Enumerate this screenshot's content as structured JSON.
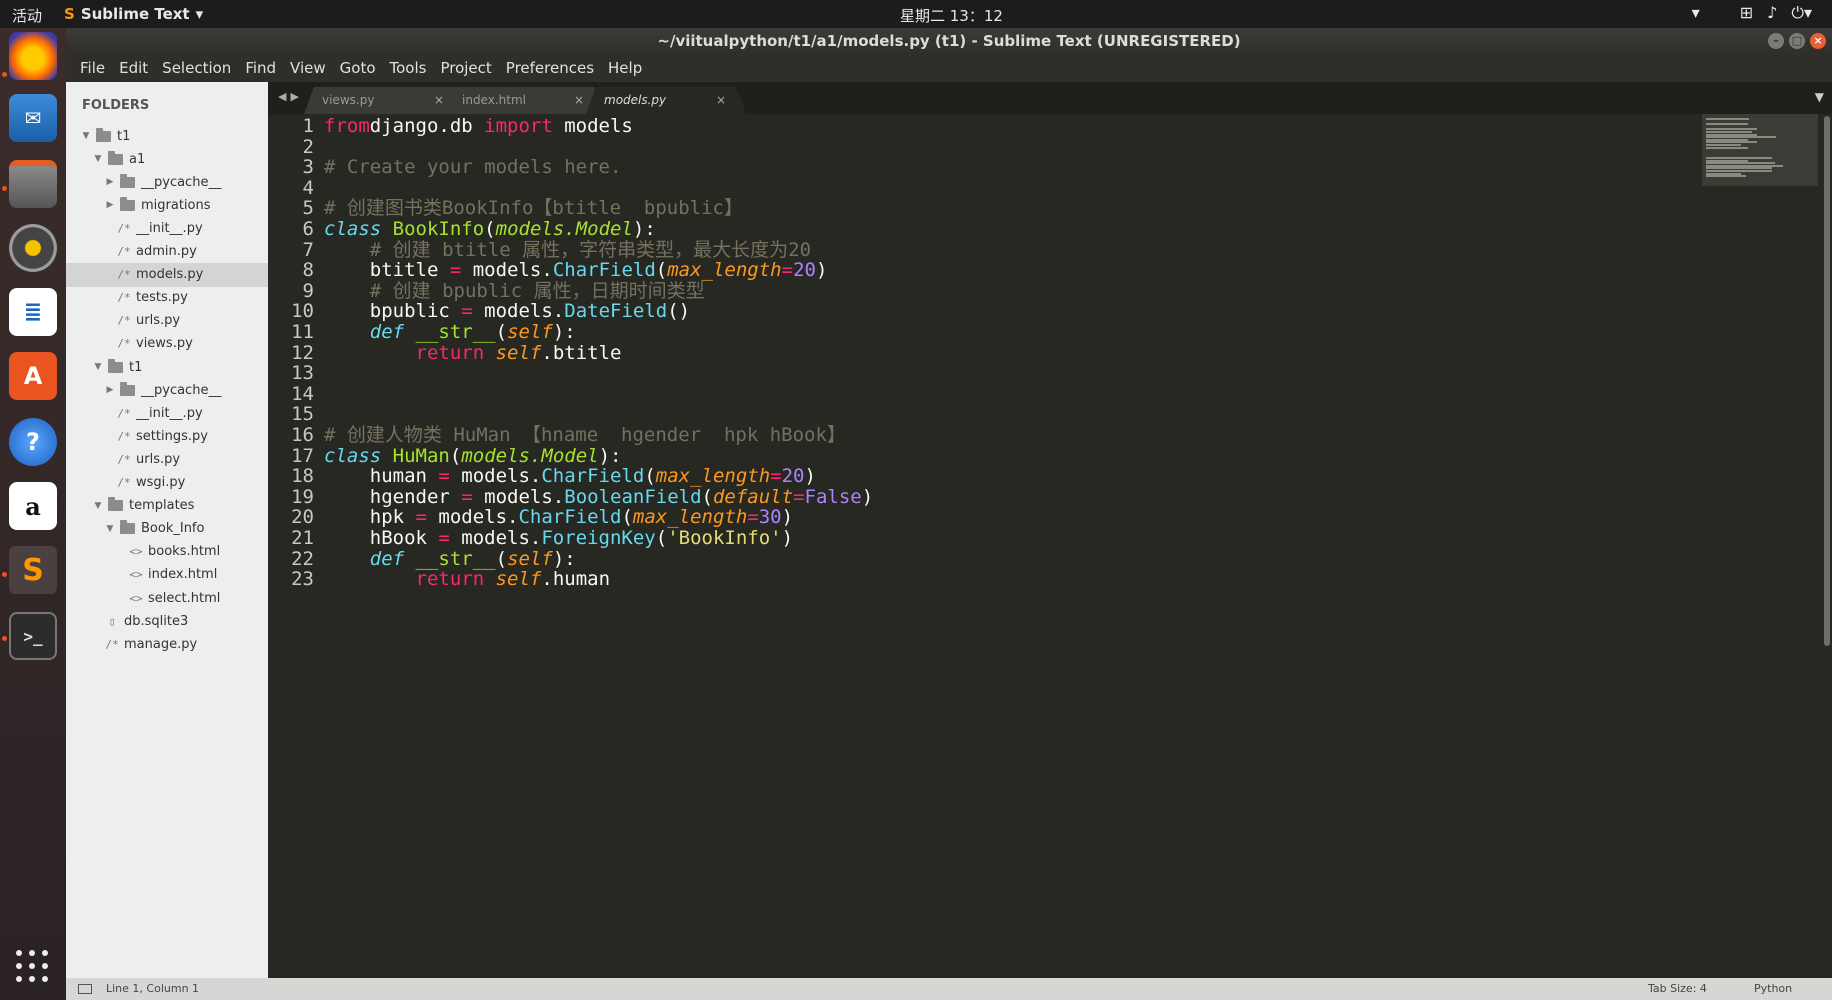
{
  "topbar": {
    "activities": "活动",
    "app_name": "Sublime Text",
    "clock": "星期二 13：12"
  },
  "window": {
    "title": "~/viitualpython/t1/a1/models.py (t1) - Sublime Text (UNREGISTERED)"
  },
  "menu": [
    "File",
    "Edit",
    "Selection",
    "Find",
    "View",
    "Goto",
    "Tools",
    "Project",
    "Preferences",
    "Help"
  ],
  "sidebar": {
    "header": "FOLDERS",
    "items": [
      {
        "label": "t1",
        "kind": "folder",
        "open": true,
        "depth": 0
      },
      {
        "label": "a1",
        "kind": "folder",
        "open": true,
        "depth": 1
      },
      {
        "label": "__pycache__",
        "kind": "folder",
        "open": false,
        "depth": 2
      },
      {
        "label": "migrations",
        "kind": "folder",
        "open": false,
        "depth": 2
      },
      {
        "label": "__init__.py",
        "kind": "py",
        "depth": 2
      },
      {
        "label": "admin.py",
        "kind": "py",
        "depth": 2
      },
      {
        "label": "models.py",
        "kind": "py",
        "depth": 2,
        "selected": true
      },
      {
        "label": "tests.py",
        "kind": "py",
        "depth": 2
      },
      {
        "label": "urls.py",
        "kind": "py",
        "depth": 2
      },
      {
        "label": "views.py",
        "kind": "py",
        "depth": 2
      },
      {
        "label": "t1",
        "kind": "folder",
        "open": true,
        "depth": 1
      },
      {
        "label": "__pycache__",
        "kind": "folder",
        "open": false,
        "depth": 2
      },
      {
        "label": "__init__.py",
        "kind": "py",
        "depth": 2
      },
      {
        "label": "settings.py",
        "kind": "py",
        "depth": 2
      },
      {
        "label": "urls.py",
        "kind": "py",
        "depth": 2
      },
      {
        "label": "wsgi.py",
        "kind": "py",
        "depth": 2
      },
      {
        "label": "templates",
        "kind": "folder",
        "open": true,
        "depth": 1
      },
      {
        "label": "Book_Info",
        "kind": "folder",
        "open": true,
        "depth": 2
      },
      {
        "label": "books.html",
        "kind": "html",
        "depth": 3
      },
      {
        "label": "index.html",
        "kind": "html",
        "depth": 3
      },
      {
        "label": "select.html",
        "kind": "html",
        "depth": 3
      },
      {
        "label": "db.sqlite3",
        "kind": "file",
        "depth": 1
      },
      {
        "label": "manage.py",
        "kind": "py",
        "depth": 1
      }
    ]
  },
  "tabs": [
    {
      "label": "views.py",
      "active": false
    },
    {
      "label": "index.html",
      "active": false
    },
    {
      "label": "models.py",
      "active": true
    }
  ],
  "editor": {
    "line_numbers": [
      "1",
      "2",
      "3",
      "4",
      "5",
      "6",
      "7",
      "8",
      "9",
      "10",
      "11",
      "12",
      "13",
      "14",
      "15",
      "16",
      "17",
      "18",
      "19",
      "20",
      "21",
      "22",
      "23"
    ],
    "lines": [
      [
        [
          "kw",
          "from"
        ],
        [
          "",
          "django.db "
        ],
        [
          "kw",
          "import"
        ],
        [
          "",
          " models"
        ]
      ],
      [],
      [
        [
          "cm",
          "# Create your models here."
        ]
      ],
      [],
      [
        [
          "cm",
          "# 创建图书类BookInfo【btitle  bpublic】"
        ]
      ],
      [
        [
          "st",
          "class"
        ],
        [
          "",
          " "
        ],
        [
          "cls",
          "BookInfo"
        ],
        [
          "",
          "("
        ],
        [
          "inh",
          "models.Model"
        ],
        [
          "",
          "):"
        ]
      ],
      [
        [
          "",
          "    "
        ],
        [
          "cm",
          "# 创建 btitle 属性，字符串类型，最大长度为20"
        ]
      ],
      [
        [
          "",
          "    btitle "
        ],
        [
          "op",
          "="
        ],
        [
          "",
          " models."
        ],
        [
          "fn",
          "CharField"
        ],
        [
          "",
          "("
        ],
        [
          "par",
          "max_length"
        ],
        [
          "op",
          "="
        ],
        [
          "num",
          "20"
        ],
        [
          "",
          ")"
        ]
      ],
      [
        [
          "",
          "    "
        ],
        [
          "cm",
          "# 创建 bpublic 属性，日期时间类型"
        ]
      ],
      [
        [
          "",
          "    bpublic "
        ],
        [
          "op",
          "="
        ],
        [
          "",
          " models."
        ],
        [
          "fn",
          "DateField"
        ],
        [
          "",
          "()"
        ]
      ],
      [
        [
          "",
          "    "
        ],
        [
          "st",
          "def"
        ],
        [
          "",
          " "
        ],
        [
          "dn",
          "__str__"
        ],
        [
          "",
          "("
        ],
        [
          "par",
          "self"
        ],
        [
          "",
          "):"
        ]
      ],
      [
        [
          "",
          "        "
        ],
        [
          "kw",
          "return"
        ],
        [
          "",
          " "
        ],
        [
          "par",
          "self"
        ],
        [
          "",
          ".btitle"
        ]
      ],
      [],
      [],
      [],
      [
        [
          "cm",
          "# 创建人物类 HuMan 【hname  hgender  hpk hBook】"
        ]
      ],
      [
        [
          "st",
          "class"
        ],
        [
          "",
          " "
        ],
        [
          "cls",
          "HuMan"
        ],
        [
          "",
          "("
        ],
        [
          "inh",
          "models.Model"
        ],
        [
          "",
          "):"
        ]
      ],
      [
        [
          "",
          "    human "
        ],
        [
          "op",
          "="
        ],
        [
          "",
          " models."
        ],
        [
          "fn",
          "CharField"
        ],
        [
          "",
          "("
        ],
        [
          "par",
          "max_length"
        ],
        [
          "op",
          "="
        ],
        [
          "num",
          "20"
        ],
        [
          "",
          ")"
        ]
      ],
      [
        [
          "",
          "    hgender "
        ],
        [
          "op",
          "="
        ],
        [
          "",
          " models."
        ],
        [
          "fn",
          "BooleanField"
        ],
        [
          "",
          "("
        ],
        [
          "par",
          "default"
        ],
        [
          "op",
          "="
        ],
        [
          "num",
          "False"
        ],
        [
          "",
          ")"
        ]
      ],
      [
        [
          "",
          "    hpk "
        ],
        [
          "op",
          "="
        ],
        [
          "",
          " models."
        ],
        [
          "fn",
          "CharField"
        ],
        [
          "",
          "("
        ],
        [
          "par",
          "max_length"
        ],
        [
          "op",
          "="
        ],
        [
          "num",
          "30"
        ],
        [
          "",
          ")"
        ]
      ],
      [
        [
          "",
          "    hBook "
        ],
        [
          "op",
          "="
        ],
        [
          "",
          " models."
        ],
        [
          "fn",
          "ForeignKey"
        ],
        [
          "",
          "("
        ],
        [
          "s",
          "'BookInfo'"
        ],
        [
          "",
          ")"
        ]
      ],
      [
        [
          "",
          "    "
        ],
        [
          "st",
          "def"
        ],
        [
          "",
          " "
        ],
        [
          "dn",
          "__str__"
        ],
        [
          "",
          "("
        ],
        [
          "par",
          "self"
        ],
        [
          "",
          "):"
        ]
      ],
      [
        [
          "",
          "        "
        ],
        [
          "kw",
          "return"
        ],
        [
          "",
          " "
        ],
        [
          "par",
          "self"
        ],
        [
          "",
          ".human"
        ]
      ]
    ]
  },
  "status": {
    "position": "Line 1, Column 1",
    "tab_size": "Tab Size: 4",
    "syntax": "Python"
  },
  "colors": {
    "accent": "#e95420",
    "editor_bg": "#272822",
    "keyword": "#f92672",
    "function": "#66d9ef",
    "class": "#a6e22e",
    "param": "#fd971f",
    "number": "#ae81ff",
    "comment": "#75715e",
    "string": "#e6db74"
  },
  "dock": [
    "firefox-icon",
    "thunderbird-icon",
    "files-icon",
    "rhythmbox-icon",
    "writer-icon",
    "software-center-icon",
    "help-icon",
    "amazon-icon",
    "sublime-text-icon",
    "terminal-icon"
  ]
}
